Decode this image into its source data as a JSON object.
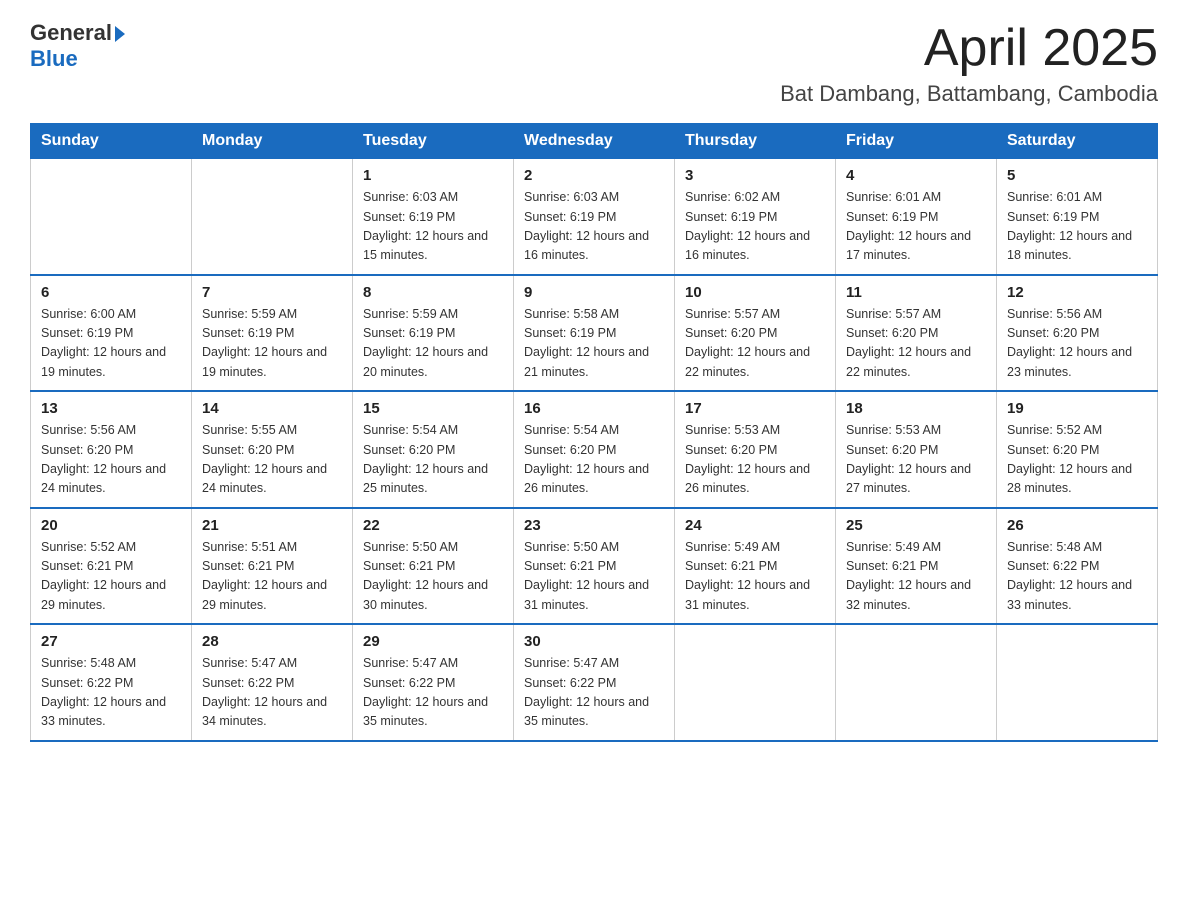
{
  "header": {
    "logo_general": "General",
    "logo_blue": "Blue",
    "title": "April 2025",
    "subtitle": "Bat Dambang, Battambang, Cambodia"
  },
  "calendar": {
    "days_of_week": [
      "Sunday",
      "Monday",
      "Tuesday",
      "Wednesday",
      "Thursday",
      "Friday",
      "Saturday"
    ],
    "weeks": [
      [
        {
          "day": "",
          "sunrise": "",
          "sunset": "",
          "daylight": ""
        },
        {
          "day": "",
          "sunrise": "",
          "sunset": "",
          "daylight": ""
        },
        {
          "day": "1",
          "sunrise": "Sunrise: 6:03 AM",
          "sunset": "Sunset: 6:19 PM",
          "daylight": "Daylight: 12 hours and 15 minutes."
        },
        {
          "day": "2",
          "sunrise": "Sunrise: 6:03 AM",
          "sunset": "Sunset: 6:19 PM",
          "daylight": "Daylight: 12 hours and 16 minutes."
        },
        {
          "day": "3",
          "sunrise": "Sunrise: 6:02 AM",
          "sunset": "Sunset: 6:19 PM",
          "daylight": "Daylight: 12 hours and 16 minutes."
        },
        {
          "day": "4",
          "sunrise": "Sunrise: 6:01 AM",
          "sunset": "Sunset: 6:19 PM",
          "daylight": "Daylight: 12 hours and 17 minutes."
        },
        {
          "day": "5",
          "sunrise": "Sunrise: 6:01 AM",
          "sunset": "Sunset: 6:19 PM",
          "daylight": "Daylight: 12 hours and 18 minutes."
        }
      ],
      [
        {
          "day": "6",
          "sunrise": "Sunrise: 6:00 AM",
          "sunset": "Sunset: 6:19 PM",
          "daylight": "Daylight: 12 hours and 19 minutes."
        },
        {
          "day": "7",
          "sunrise": "Sunrise: 5:59 AM",
          "sunset": "Sunset: 6:19 PM",
          "daylight": "Daylight: 12 hours and 19 minutes."
        },
        {
          "day": "8",
          "sunrise": "Sunrise: 5:59 AM",
          "sunset": "Sunset: 6:19 PM",
          "daylight": "Daylight: 12 hours and 20 minutes."
        },
        {
          "day": "9",
          "sunrise": "Sunrise: 5:58 AM",
          "sunset": "Sunset: 6:19 PM",
          "daylight": "Daylight: 12 hours and 21 minutes."
        },
        {
          "day": "10",
          "sunrise": "Sunrise: 5:57 AM",
          "sunset": "Sunset: 6:20 PM",
          "daylight": "Daylight: 12 hours and 22 minutes."
        },
        {
          "day": "11",
          "sunrise": "Sunrise: 5:57 AM",
          "sunset": "Sunset: 6:20 PM",
          "daylight": "Daylight: 12 hours and 22 minutes."
        },
        {
          "day": "12",
          "sunrise": "Sunrise: 5:56 AM",
          "sunset": "Sunset: 6:20 PM",
          "daylight": "Daylight: 12 hours and 23 minutes."
        }
      ],
      [
        {
          "day": "13",
          "sunrise": "Sunrise: 5:56 AM",
          "sunset": "Sunset: 6:20 PM",
          "daylight": "Daylight: 12 hours and 24 minutes."
        },
        {
          "day": "14",
          "sunrise": "Sunrise: 5:55 AM",
          "sunset": "Sunset: 6:20 PM",
          "daylight": "Daylight: 12 hours and 24 minutes."
        },
        {
          "day": "15",
          "sunrise": "Sunrise: 5:54 AM",
          "sunset": "Sunset: 6:20 PM",
          "daylight": "Daylight: 12 hours and 25 minutes."
        },
        {
          "day": "16",
          "sunrise": "Sunrise: 5:54 AM",
          "sunset": "Sunset: 6:20 PM",
          "daylight": "Daylight: 12 hours and 26 minutes."
        },
        {
          "day": "17",
          "sunrise": "Sunrise: 5:53 AM",
          "sunset": "Sunset: 6:20 PM",
          "daylight": "Daylight: 12 hours and 26 minutes."
        },
        {
          "day": "18",
          "sunrise": "Sunrise: 5:53 AM",
          "sunset": "Sunset: 6:20 PM",
          "daylight": "Daylight: 12 hours and 27 minutes."
        },
        {
          "day": "19",
          "sunrise": "Sunrise: 5:52 AM",
          "sunset": "Sunset: 6:20 PM",
          "daylight": "Daylight: 12 hours and 28 minutes."
        }
      ],
      [
        {
          "day": "20",
          "sunrise": "Sunrise: 5:52 AM",
          "sunset": "Sunset: 6:21 PM",
          "daylight": "Daylight: 12 hours and 29 minutes."
        },
        {
          "day": "21",
          "sunrise": "Sunrise: 5:51 AM",
          "sunset": "Sunset: 6:21 PM",
          "daylight": "Daylight: 12 hours and 29 minutes."
        },
        {
          "day": "22",
          "sunrise": "Sunrise: 5:50 AM",
          "sunset": "Sunset: 6:21 PM",
          "daylight": "Daylight: 12 hours and 30 minutes."
        },
        {
          "day": "23",
          "sunrise": "Sunrise: 5:50 AM",
          "sunset": "Sunset: 6:21 PM",
          "daylight": "Daylight: 12 hours and 31 minutes."
        },
        {
          "day": "24",
          "sunrise": "Sunrise: 5:49 AM",
          "sunset": "Sunset: 6:21 PM",
          "daylight": "Daylight: 12 hours and 31 minutes."
        },
        {
          "day": "25",
          "sunrise": "Sunrise: 5:49 AM",
          "sunset": "Sunset: 6:21 PM",
          "daylight": "Daylight: 12 hours and 32 minutes."
        },
        {
          "day": "26",
          "sunrise": "Sunrise: 5:48 AM",
          "sunset": "Sunset: 6:22 PM",
          "daylight": "Daylight: 12 hours and 33 minutes."
        }
      ],
      [
        {
          "day": "27",
          "sunrise": "Sunrise: 5:48 AM",
          "sunset": "Sunset: 6:22 PM",
          "daylight": "Daylight: 12 hours and 33 minutes."
        },
        {
          "day": "28",
          "sunrise": "Sunrise: 5:47 AM",
          "sunset": "Sunset: 6:22 PM",
          "daylight": "Daylight: 12 hours and 34 minutes."
        },
        {
          "day": "29",
          "sunrise": "Sunrise: 5:47 AM",
          "sunset": "Sunset: 6:22 PM",
          "daylight": "Daylight: 12 hours and 35 minutes."
        },
        {
          "day": "30",
          "sunrise": "Sunrise: 5:47 AM",
          "sunset": "Sunset: 6:22 PM",
          "daylight": "Daylight: 12 hours and 35 minutes."
        },
        {
          "day": "",
          "sunrise": "",
          "sunset": "",
          "daylight": ""
        },
        {
          "day": "",
          "sunrise": "",
          "sunset": "",
          "daylight": ""
        },
        {
          "day": "",
          "sunrise": "",
          "sunset": "",
          "daylight": ""
        }
      ]
    ]
  }
}
